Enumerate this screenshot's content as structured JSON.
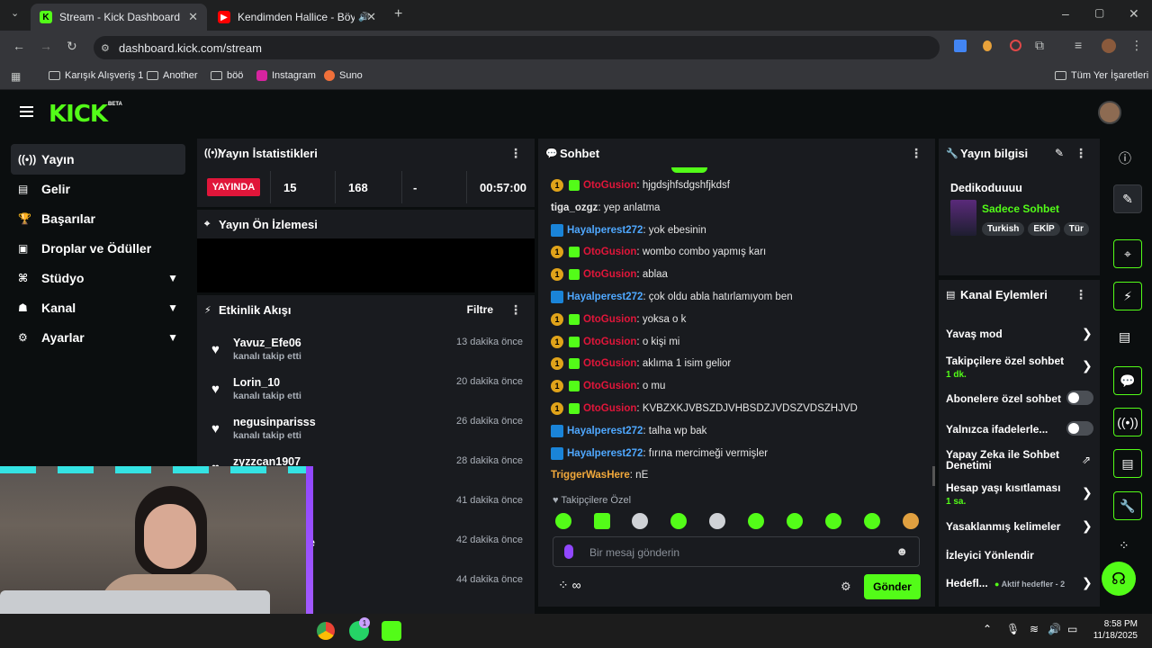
{
  "browser": {
    "tabs": [
      {
        "title": "Stream - Kick Dashboard",
        "active": true
      },
      {
        "title": "Kendimden Hallice - Böyle",
        "active": false
      }
    ],
    "url": "dashboard.kick.com/stream",
    "bookmarks": [
      "Karışık Alışveriş 1",
      "Another",
      "böö",
      "Instagram",
      "Suno"
    ],
    "all_bookmarks": "Tüm Yer İşaretleri"
  },
  "kick": {
    "logo": "KICK",
    "logo_badge": "BETA",
    "nav": [
      {
        "label": "Yayın",
        "icon": "broadcast-icon"
      },
      {
        "label": "Gelir",
        "icon": "revenue-icon"
      },
      {
        "label": "Başarılar",
        "icon": "trophy-icon"
      },
      {
        "label": "Droplar ve Ödüller",
        "icon": "gift-icon"
      },
      {
        "label": "Stüdyo",
        "icon": "studio-icon"
      },
      {
        "label": "Kanal",
        "icon": "channel-icon"
      },
      {
        "label": "Ayarlar",
        "icon": "gear-icon"
      }
    ],
    "stats": {
      "title": "Yayın İstatistikleri",
      "live": "YAYINDA",
      "viewers": "15",
      "followers": "168",
      "dash": "-",
      "duration": "00:57:00"
    },
    "preview_title": "Yayın Ön İzlemesi",
    "activity": {
      "title": "Etkinlik Akışı",
      "filter": "Filtre",
      "items": [
        {
          "name": "Yavuz_Efe06",
          "sub": "kanalı takip etti",
          "time": "13 dakika önce"
        },
        {
          "name": "Lorin_10",
          "sub": "kanalı takip etti",
          "time": "20 dakika önce"
        },
        {
          "name": "negusinparisss",
          "sub": "kanalı takip etti",
          "time": "26 dakika önce"
        },
        {
          "name": "zyzzcan1907",
          "sub": "",
          "time": "28 dakika önce"
        },
        {
          "name": "",
          "sub": "",
          "time": "41 dakika önce"
        },
        {
          "name": "e",
          "sub": "",
          "time": "42 dakika önce"
        },
        {
          "name": "",
          "sub": "",
          "time": "44 dakika önce"
        }
      ]
    },
    "chat": {
      "title": "Sohbet",
      "messages": [
        {
          "user": "OtoGusion",
          "color": "#e0163a",
          "badges": "og",
          "text": "hjgdsjhfsdgshfjkdsf"
        },
        {
          "user": "tiga_ozgz",
          "color": "#e6e6e6",
          "badges": "",
          "text": "yep anlatma"
        },
        {
          "user": "Hayalperest272",
          "color": "#4fa8ff",
          "badges": "b",
          "text": "yok ebesinin"
        },
        {
          "user": "OtoGusion",
          "color": "#e0163a",
          "badges": "og",
          "text": "wombo combo yapmış karı"
        },
        {
          "user": "OtoGusion",
          "color": "#e0163a",
          "badges": "og",
          "text": "ablaa"
        },
        {
          "user": "Hayalperest272",
          "color": "#4fa8ff",
          "badges": "b",
          "text": "çok oldu abla hatırlamıyom ben"
        },
        {
          "user": "OtoGusion",
          "color": "#e0163a",
          "badges": "og",
          "text": "yoksa o k"
        },
        {
          "user": "OtoGusion",
          "color": "#e0163a",
          "badges": "og",
          "text": "o kişi mi"
        },
        {
          "user": "OtoGusion",
          "color": "#e0163a",
          "badges": "og",
          "text": "aklıma 1 isim gelior"
        },
        {
          "user": "OtoGusion",
          "color": "#e0163a",
          "badges": "og",
          "text": "o mu"
        },
        {
          "user": "OtoGusion",
          "color": "#e0163a",
          "badges": "og",
          "text": "KVBZXKJVBSZDJVHBSDZJVDSZVDSZHJVD"
        },
        {
          "user": "Hayalperest272",
          "color": "#4fa8ff",
          "badges": "b",
          "text": "talha wp bak"
        },
        {
          "user": "Hayalperest272",
          "color": "#4fa8ff",
          "badges": "b",
          "text": "fırına mercimeği vermişler"
        },
        {
          "user": "TriggerWasHere",
          "color": "#f2a93b",
          "badges": "",
          "text": "nE"
        }
      ],
      "followers_only": "Takipçilere Özel",
      "placeholder": "Bir mesaj gönderin",
      "send": "Gönder",
      "infinity": "∞"
    },
    "stream_info": {
      "title": "Yayın bilgisi",
      "stream_title": "Dedikoduuuu",
      "category": "Sadece Sohbet",
      "tags": [
        "Turkish",
        "EKİP",
        "Tür"
      ]
    },
    "channel_actions": {
      "title": "Kanal Eylemleri",
      "items": [
        {
          "label": "Yavaş mod",
          "sub": "",
          "control": "chevron"
        },
        {
          "label": "Takipçilere özel sohbet",
          "sub": "1 dk.",
          "control": "chevron"
        },
        {
          "label": "Abonelere özel sohbet",
          "sub": "",
          "control": "toggle"
        },
        {
          "label": "Yalnızca ifadelerle...",
          "sub": "",
          "control": "toggle"
        },
        {
          "label": "Yapay Zeka ile Sohbet Denetimi",
          "sub": "",
          "control": "external"
        },
        {
          "label": "Hesap yaşı kısıtlaması",
          "sub": "1 sa.",
          "control": "chevron"
        },
        {
          "label": "Yasaklanmış kelimeler",
          "sub": "",
          "control": "chevron"
        },
        {
          "label": "İzleyici Yönlendir",
          "sub": "",
          "control": "none"
        },
        {
          "label": "Hedefl...",
          "sub": "Aktif hedefler - 2",
          "control": "chevron"
        }
      ]
    }
  },
  "taskbar": {
    "time": "8:58 PM",
    "date": "11/18/2025",
    "whatsapp_badge": "1"
  },
  "colors": {
    "kick_green": "#53fc18",
    "live_red": "#e0163a"
  }
}
